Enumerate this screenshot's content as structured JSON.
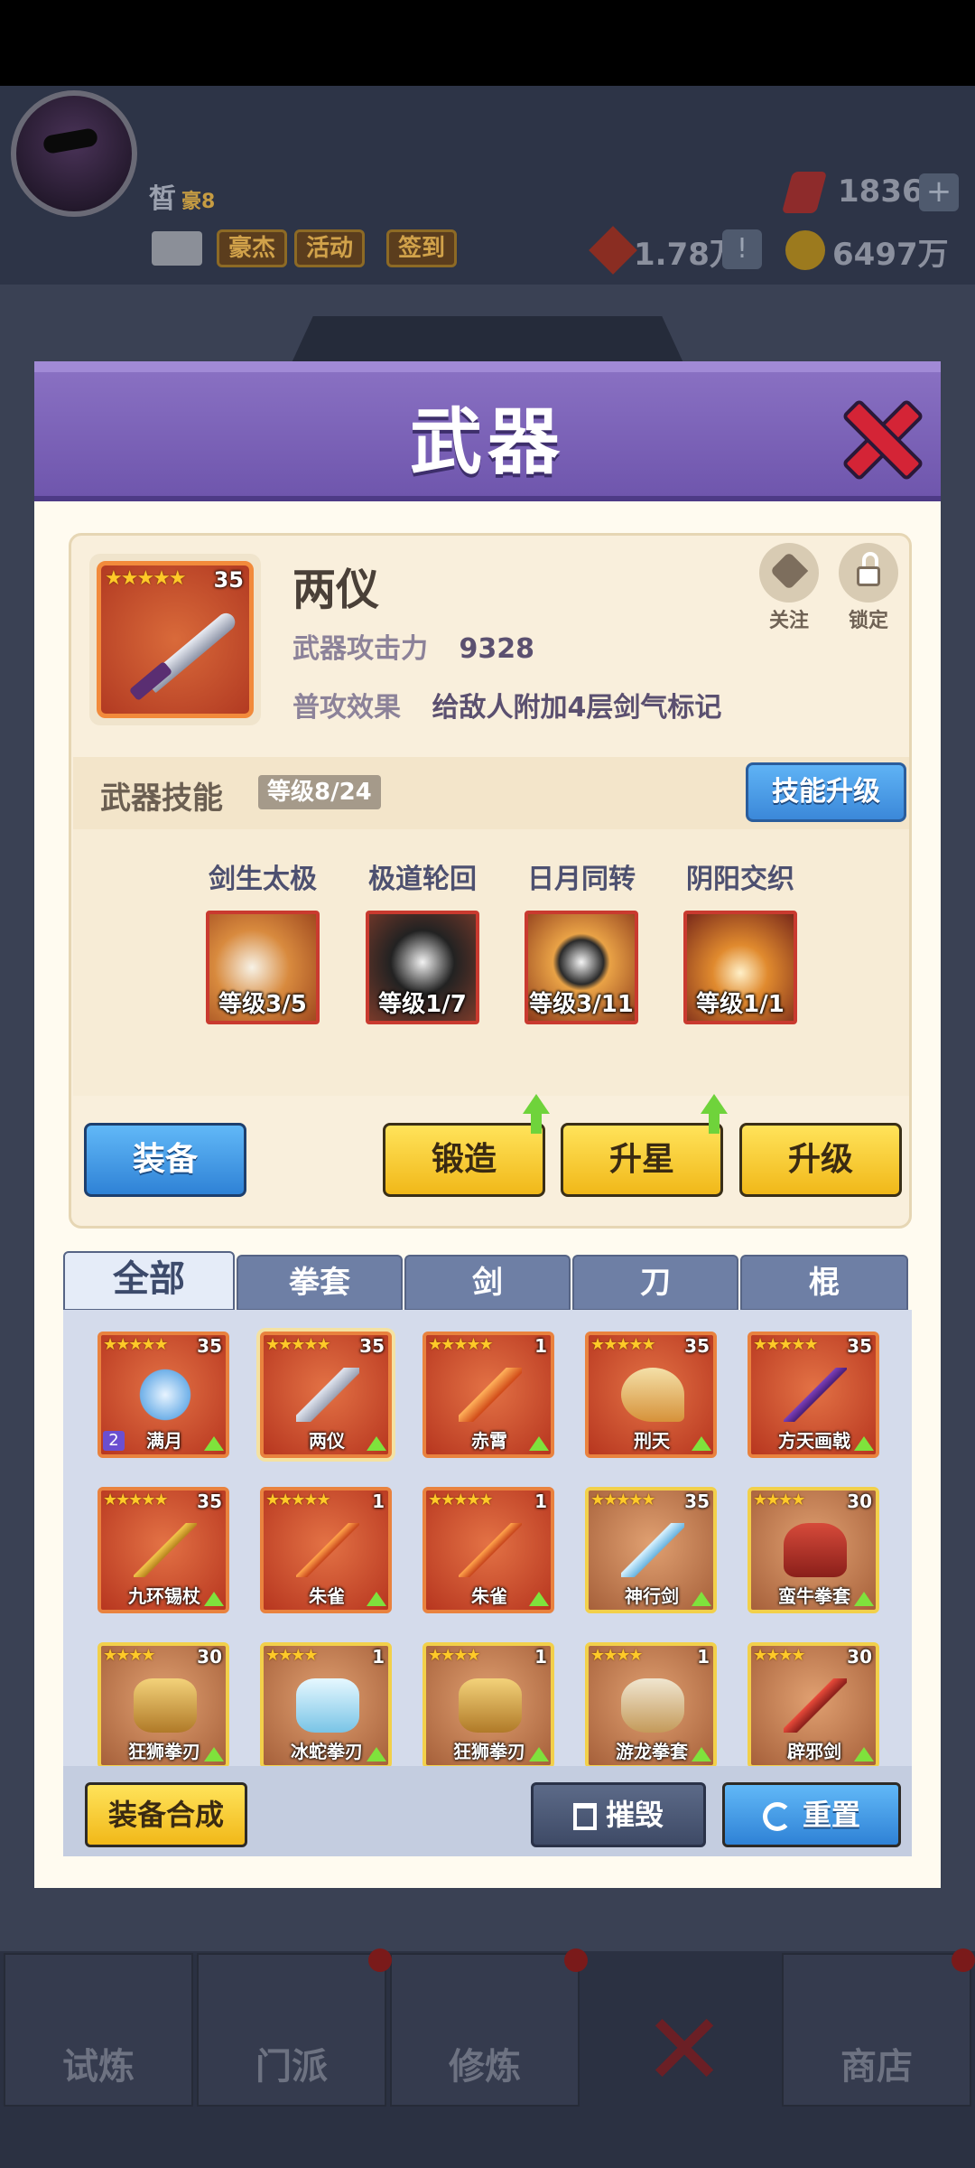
{
  "hud": {
    "player_name": "皙",
    "player_tag": "豪8",
    "buttons": [
      "豪杰",
      "活动",
      "签到"
    ],
    "gems": "1836",
    "diamonds": "1.78万",
    "coins": "6497万",
    "bg_tab": "装备"
  },
  "modal": {
    "title": "武器",
    "weapon": {
      "name": "两仪",
      "stars": "★★★★★",
      "level": "35",
      "attack_label": "武器攻击力",
      "attack_value": "9328",
      "effect_label": "普攻效果",
      "effect_value": "给敌人附加4层剑气标记",
      "follow_label": "关注",
      "lock_label": "锁定"
    },
    "skills_header": {
      "title": "武器技能",
      "level_badge": "等级8/24",
      "upgrade_button": "技能升级"
    },
    "skills": [
      {
        "name": "剑生太极",
        "level": "等级3/5"
      },
      {
        "name": "极道轮回",
        "level": "等级1/7"
      },
      {
        "name": "日月同转",
        "level": "等级3/11"
      },
      {
        "name": "阴阳交织",
        "level": "等级1/1"
      }
    ],
    "actions": {
      "equip": "装备",
      "forge": "锻造",
      "star_up": "升星",
      "level_up": "升级"
    },
    "tabs": [
      "全部",
      "拳套",
      "剑",
      "刀",
      "棍"
    ],
    "items": [
      {
        "name": "满月",
        "stars": "★★★★★",
        "level": "35",
        "badge": "2"
      },
      {
        "name": "两仪",
        "stars": "★★★★★",
        "level": "35"
      },
      {
        "name": "赤霄",
        "stars": "★★★★★",
        "level": "1"
      },
      {
        "name": "刑天",
        "stars": "★★★★★",
        "level": "35"
      },
      {
        "name": "方天画戟",
        "stars": "★★★★★",
        "level": "35"
      },
      {
        "name": "九环锡杖",
        "stars": "★★★★★",
        "level": "35"
      },
      {
        "name": "朱雀",
        "stars": "★★★★★",
        "level": "1"
      },
      {
        "name": "朱雀",
        "stars": "★★★★★",
        "level": "1"
      },
      {
        "name": "神行剑",
        "stars": "★★★★★",
        "level": "35"
      },
      {
        "name": "蛮牛拳套",
        "stars": "★★★★",
        "level": "30"
      },
      {
        "name": "狂狮拳刃",
        "stars": "★★★★",
        "level": "30"
      },
      {
        "name": "冰蛇拳刃",
        "stars": "★★★★",
        "level": "1"
      },
      {
        "name": "狂狮拳刃",
        "stars": "★★★★",
        "level": "1"
      },
      {
        "name": "游龙拳套",
        "stars": "★★★★",
        "level": "1"
      },
      {
        "name": "辟邪剑",
        "stars": "★★★★",
        "level": "30"
      }
    ],
    "bottom": {
      "synthesize": "装备合成",
      "destroy": "摧毁",
      "reset": "重置"
    }
  },
  "nav": [
    "试炼",
    "门派",
    "修炼",
    "",
    "商店"
  ],
  "colors": {
    "header_purple": "#7a62b8",
    "red_frame": "#e9823e",
    "gold_frame": "#f2d04a",
    "blue_button": "#3b88d9",
    "yellow_button": "#f1b819"
  }
}
